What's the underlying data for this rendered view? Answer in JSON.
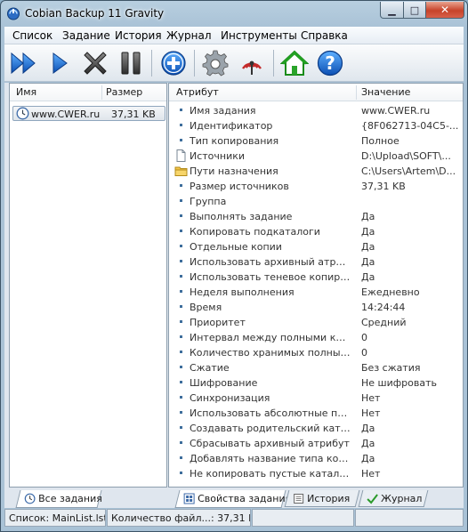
{
  "window": {
    "title": "Cobian Backup 11 Gravity"
  },
  "menu": [
    "Список",
    "Задание",
    "История",
    "Журнал",
    "Инструменты",
    "Справка"
  ],
  "toolbar_icons": [
    "run-all-icon",
    "run-selected-icon",
    "cancel-icon",
    "pause-icon",
    "add-task-icon",
    "options-icon",
    "remote-icon",
    "home-icon",
    "help-icon"
  ],
  "tasks_panel": {
    "col_name": "Имя",
    "col_size": "Размер",
    "items": [
      {
        "name": "www.CWER.ru",
        "size": "37,31 KB"
      }
    ]
  },
  "properties_panel": {
    "col_attr": "Атрибут",
    "col_value": "Значение",
    "rows": [
      {
        "attr": "Имя задания",
        "value": "www.CWER.ru",
        "icon": "bullet"
      },
      {
        "attr": "Идентификатор",
        "value": "{8F062713-04C5-...",
        "icon": "bullet"
      },
      {
        "attr": "Тип копирования",
        "value": "Полное",
        "icon": "bullet"
      },
      {
        "attr": "Источники",
        "value": "D:\\Upload\\SOFT\\...",
        "icon": "file"
      },
      {
        "attr": "Пути назначения",
        "value": "C:\\Users\\Artem\\D...",
        "icon": "folder"
      },
      {
        "attr": "Размер источников",
        "value": "37,31 KB",
        "icon": "bullet"
      },
      {
        "attr": "Группа",
        "value": "",
        "icon": "bullet"
      },
      {
        "attr": "Выполнять задание",
        "value": "Да",
        "icon": "bullet"
      },
      {
        "attr": "Копировать подкаталоги",
        "value": "Да",
        "icon": "bullet"
      },
      {
        "attr": "Отдельные копии",
        "value": "Да",
        "icon": "bullet"
      },
      {
        "attr": "Использовать архивный атрибут",
        "value": "Да",
        "icon": "bullet"
      },
      {
        "attr": "Использовать теневое копирова...",
        "value": "Да",
        "icon": "bullet"
      },
      {
        "attr": "Неделя выполнения",
        "value": "Ежедневно",
        "icon": "bullet"
      },
      {
        "attr": "Время",
        "value": "14:24:44",
        "icon": "bullet"
      },
      {
        "attr": "Приоритет",
        "value": "Средний",
        "icon": "bullet"
      },
      {
        "attr": "Интервал между полными копиями",
        "value": "0",
        "icon": "bullet"
      },
      {
        "attr": "Количество хранимых полных ко...",
        "value": "0",
        "icon": "bullet"
      },
      {
        "attr": "Сжатие",
        "value": "Без сжатия",
        "icon": "bullet"
      },
      {
        "attr": "Шифрование",
        "value": "Не шифровать",
        "icon": "bullet"
      },
      {
        "attr": "Синхронизация",
        "value": "Нет",
        "icon": "bullet"
      },
      {
        "attr": "Использовать абсолютные пути",
        "value": "Нет",
        "icon": "bullet"
      },
      {
        "attr": "Создавать родительский каталог",
        "value": "Да",
        "icon": "bullet"
      },
      {
        "attr": "Сбрасывать архивный атрибут",
        "value": "Да",
        "icon": "bullet"
      },
      {
        "attr": "Добавлять название типа копир...",
        "value": "Да",
        "icon": "bullet"
      },
      {
        "attr": "Не копировать пустые каталоги",
        "value": "Нет",
        "icon": "bullet"
      }
    ]
  },
  "tabs_left": [
    {
      "label": "Все задания",
      "active": true
    }
  ],
  "tabs_right": [
    {
      "label": "Свойства задания",
      "active": true
    },
    {
      "label": "История",
      "active": false
    },
    {
      "label": "Журнал",
      "active": false
    }
  ],
  "status": {
    "list": "Список: MainList.lst",
    "count": "Количество файл...: 37,31 KB",
    "cell3": "",
    "cell4": ""
  }
}
